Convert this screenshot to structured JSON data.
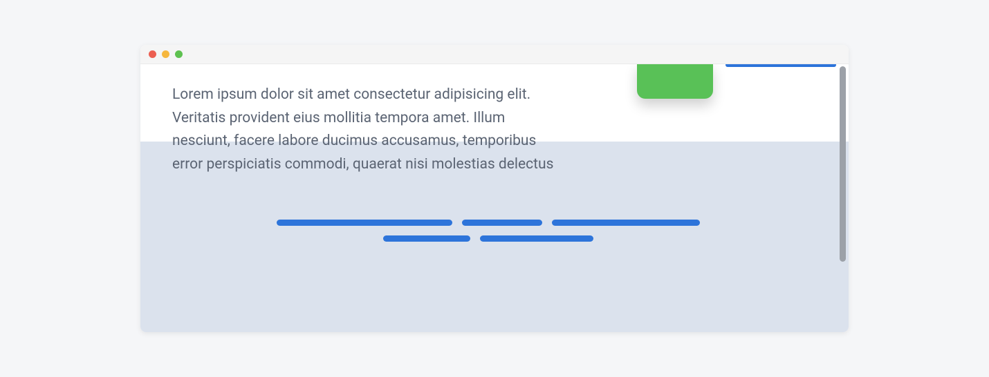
{
  "window": {
    "traffic_lights": {
      "close": "close",
      "minimize": "minimize",
      "maximize": "maximize"
    }
  },
  "content": {
    "body_text": "Lorem ipsum dolor sit amet consectetur adipisicing elit. Veritatis provident eius mollitia tempora amet. Illum nesciunt, facere labore ducimus accusamus, temporibus error perspiciatis commodi, quaerat nisi molestias delectus"
  },
  "colors": {
    "accent_blue": "#2d74da",
    "accent_green": "#59c157",
    "body_text": "#5b6473",
    "panel_bg": "#dbe2ed"
  }
}
